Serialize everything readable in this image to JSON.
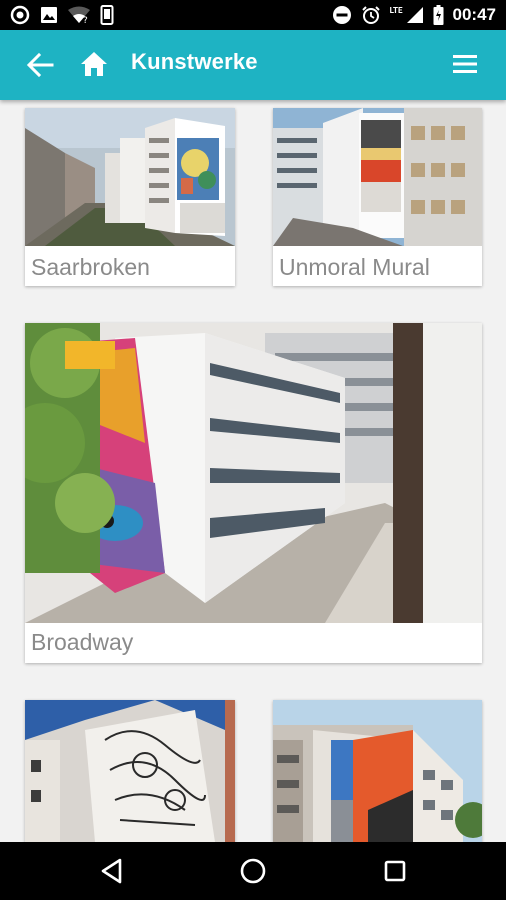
{
  "status_bar": {
    "time": "00:47",
    "network_label": "LTE",
    "left_icons": [
      "circle-notification-icon",
      "image-notification-icon",
      "wifi-question-icon",
      "phone-vibrate-icon"
    ],
    "right_icons": [
      "do-not-disturb-icon",
      "alarm-icon",
      "signal-icon",
      "battery-icon"
    ]
  },
  "app_bar": {
    "title": "Kunstwerke",
    "background_color": "#1eb3c3",
    "icons": [
      "back-arrow-icon",
      "home-icon",
      "hamburger-menu-icon"
    ]
  },
  "artworks": [
    {
      "title": "Saarbroken"
    },
    {
      "title": "Unmoral Mural"
    },
    {
      "title": "Broadway"
    },
    {
      "title": ""
    },
    {
      "title": ""
    }
  ],
  "nav_bar": {
    "icons": [
      "back-triangle-icon",
      "home-circle-icon",
      "recents-square-icon"
    ]
  }
}
